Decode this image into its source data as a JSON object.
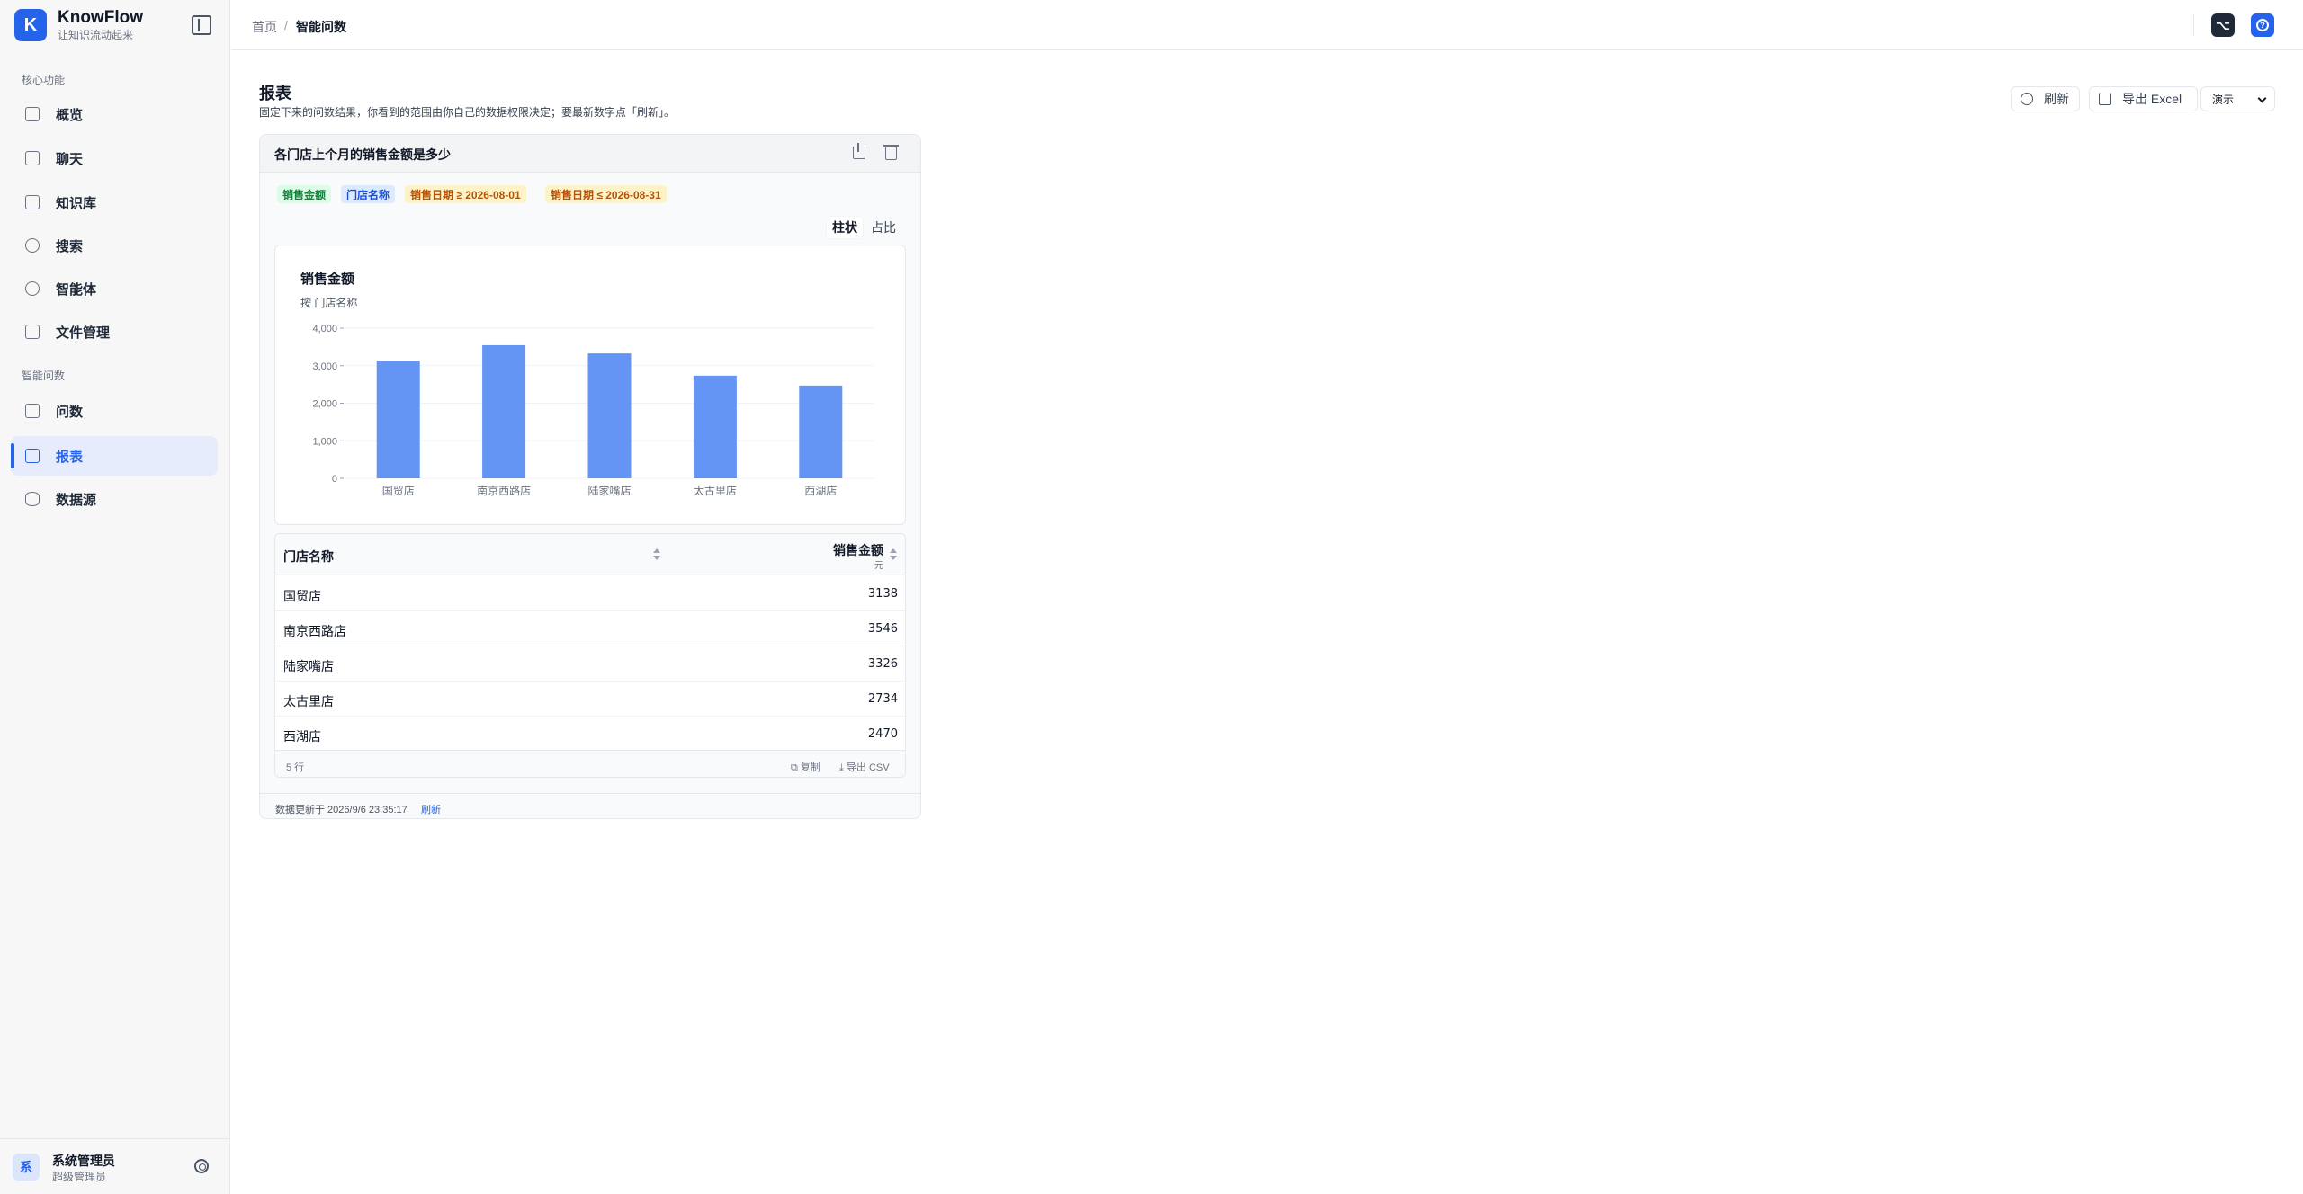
{
  "brand": {
    "logo_letter": "K",
    "name": "KnowFlow",
    "tagline": "让知识流动起来"
  },
  "sidebar": {
    "section_core": "核心功能",
    "core_items": [
      {
        "label": "概览",
        "icon": "dashboard-icon"
      },
      {
        "label": "聊天",
        "icon": "chat-icon"
      },
      {
        "label": "知识库",
        "icon": "book-icon"
      },
      {
        "label": "搜索",
        "icon": "search-icon"
      },
      {
        "label": "智能体",
        "icon": "bot-icon"
      },
      {
        "label": "文件管理",
        "icon": "file-icon"
      }
    ],
    "section_ask": "智能问数",
    "ask_items": [
      {
        "label": "问数",
        "icon": "message-icon"
      },
      {
        "label": "报表",
        "icon": "report-icon",
        "active": true
      },
      {
        "label": "数据源",
        "icon": "database-icon"
      }
    ]
  },
  "user": {
    "avatar_letter": "系",
    "name": "系统管理员",
    "role": "超级管理员"
  },
  "breadcrumb": {
    "home": "首页",
    "separator": "/",
    "current": "智能问数"
  },
  "page": {
    "title": "报表",
    "description": "固定下来的问数结果，你看到的范围由你自己的数据权限决定；要最新数字点「刷新」。",
    "refresh_label": "刷新",
    "export_label": "导出 Excel",
    "mode_select": "演示"
  },
  "card": {
    "title": "各门店上个月的销售金额是多少",
    "chips": {
      "metric": "销售金额",
      "dimension": "门店名称",
      "filter_from": "销售日期 ≥ 2026-08-01",
      "filter_to": "销售日期 ≤ 2026-08-31"
    },
    "tabs": {
      "bar": "柱状",
      "pie": "占比"
    },
    "table": {
      "col_name": "门店名称",
      "col_value": "销售金额",
      "col_unit": "元",
      "rows": [
        {
          "name": "国贸店",
          "value": "3138"
        },
        {
          "name": "南京西路店",
          "value": "3546"
        },
        {
          "name": "陆家嘴店",
          "value": "3326"
        },
        {
          "name": "太古里店",
          "value": "2734"
        },
        {
          "name": "西湖店",
          "value": "2470"
        }
      ],
      "row_count": "5 行",
      "copy_label": "复制",
      "csv_label": "导出 CSV"
    },
    "updated_text": "数据更新于 2026/9/6 23:35:17",
    "refresh_link": "刷新"
  },
  "colors": {
    "accent": "#2563eb",
    "bar": "#6495f5"
  },
  "chart_data": {
    "type": "bar",
    "title": "销售金额",
    "subtitle": "按 门店名称",
    "categories": [
      "国贸店",
      "南京西路店",
      "陆家嘴店",
      "太古里店",
      "西湖店"
    ],
    "values": [
      3138,
      3546,
      3326,
      2734,
      2470
    ],
    "ylim": [
      0,
      4000
    ],
    "yticks": [
      0,
      1000,
      2000,
      3000,
      4000
    ],
    "ytick_labels": [
      "0",
      "1,000",
      "2,000",
      "3,000",
      "4,000"
    ],
    "xlabel": "",
    "ylabel": "",
    "grid": true,
    "legend": "none"
  }
}
